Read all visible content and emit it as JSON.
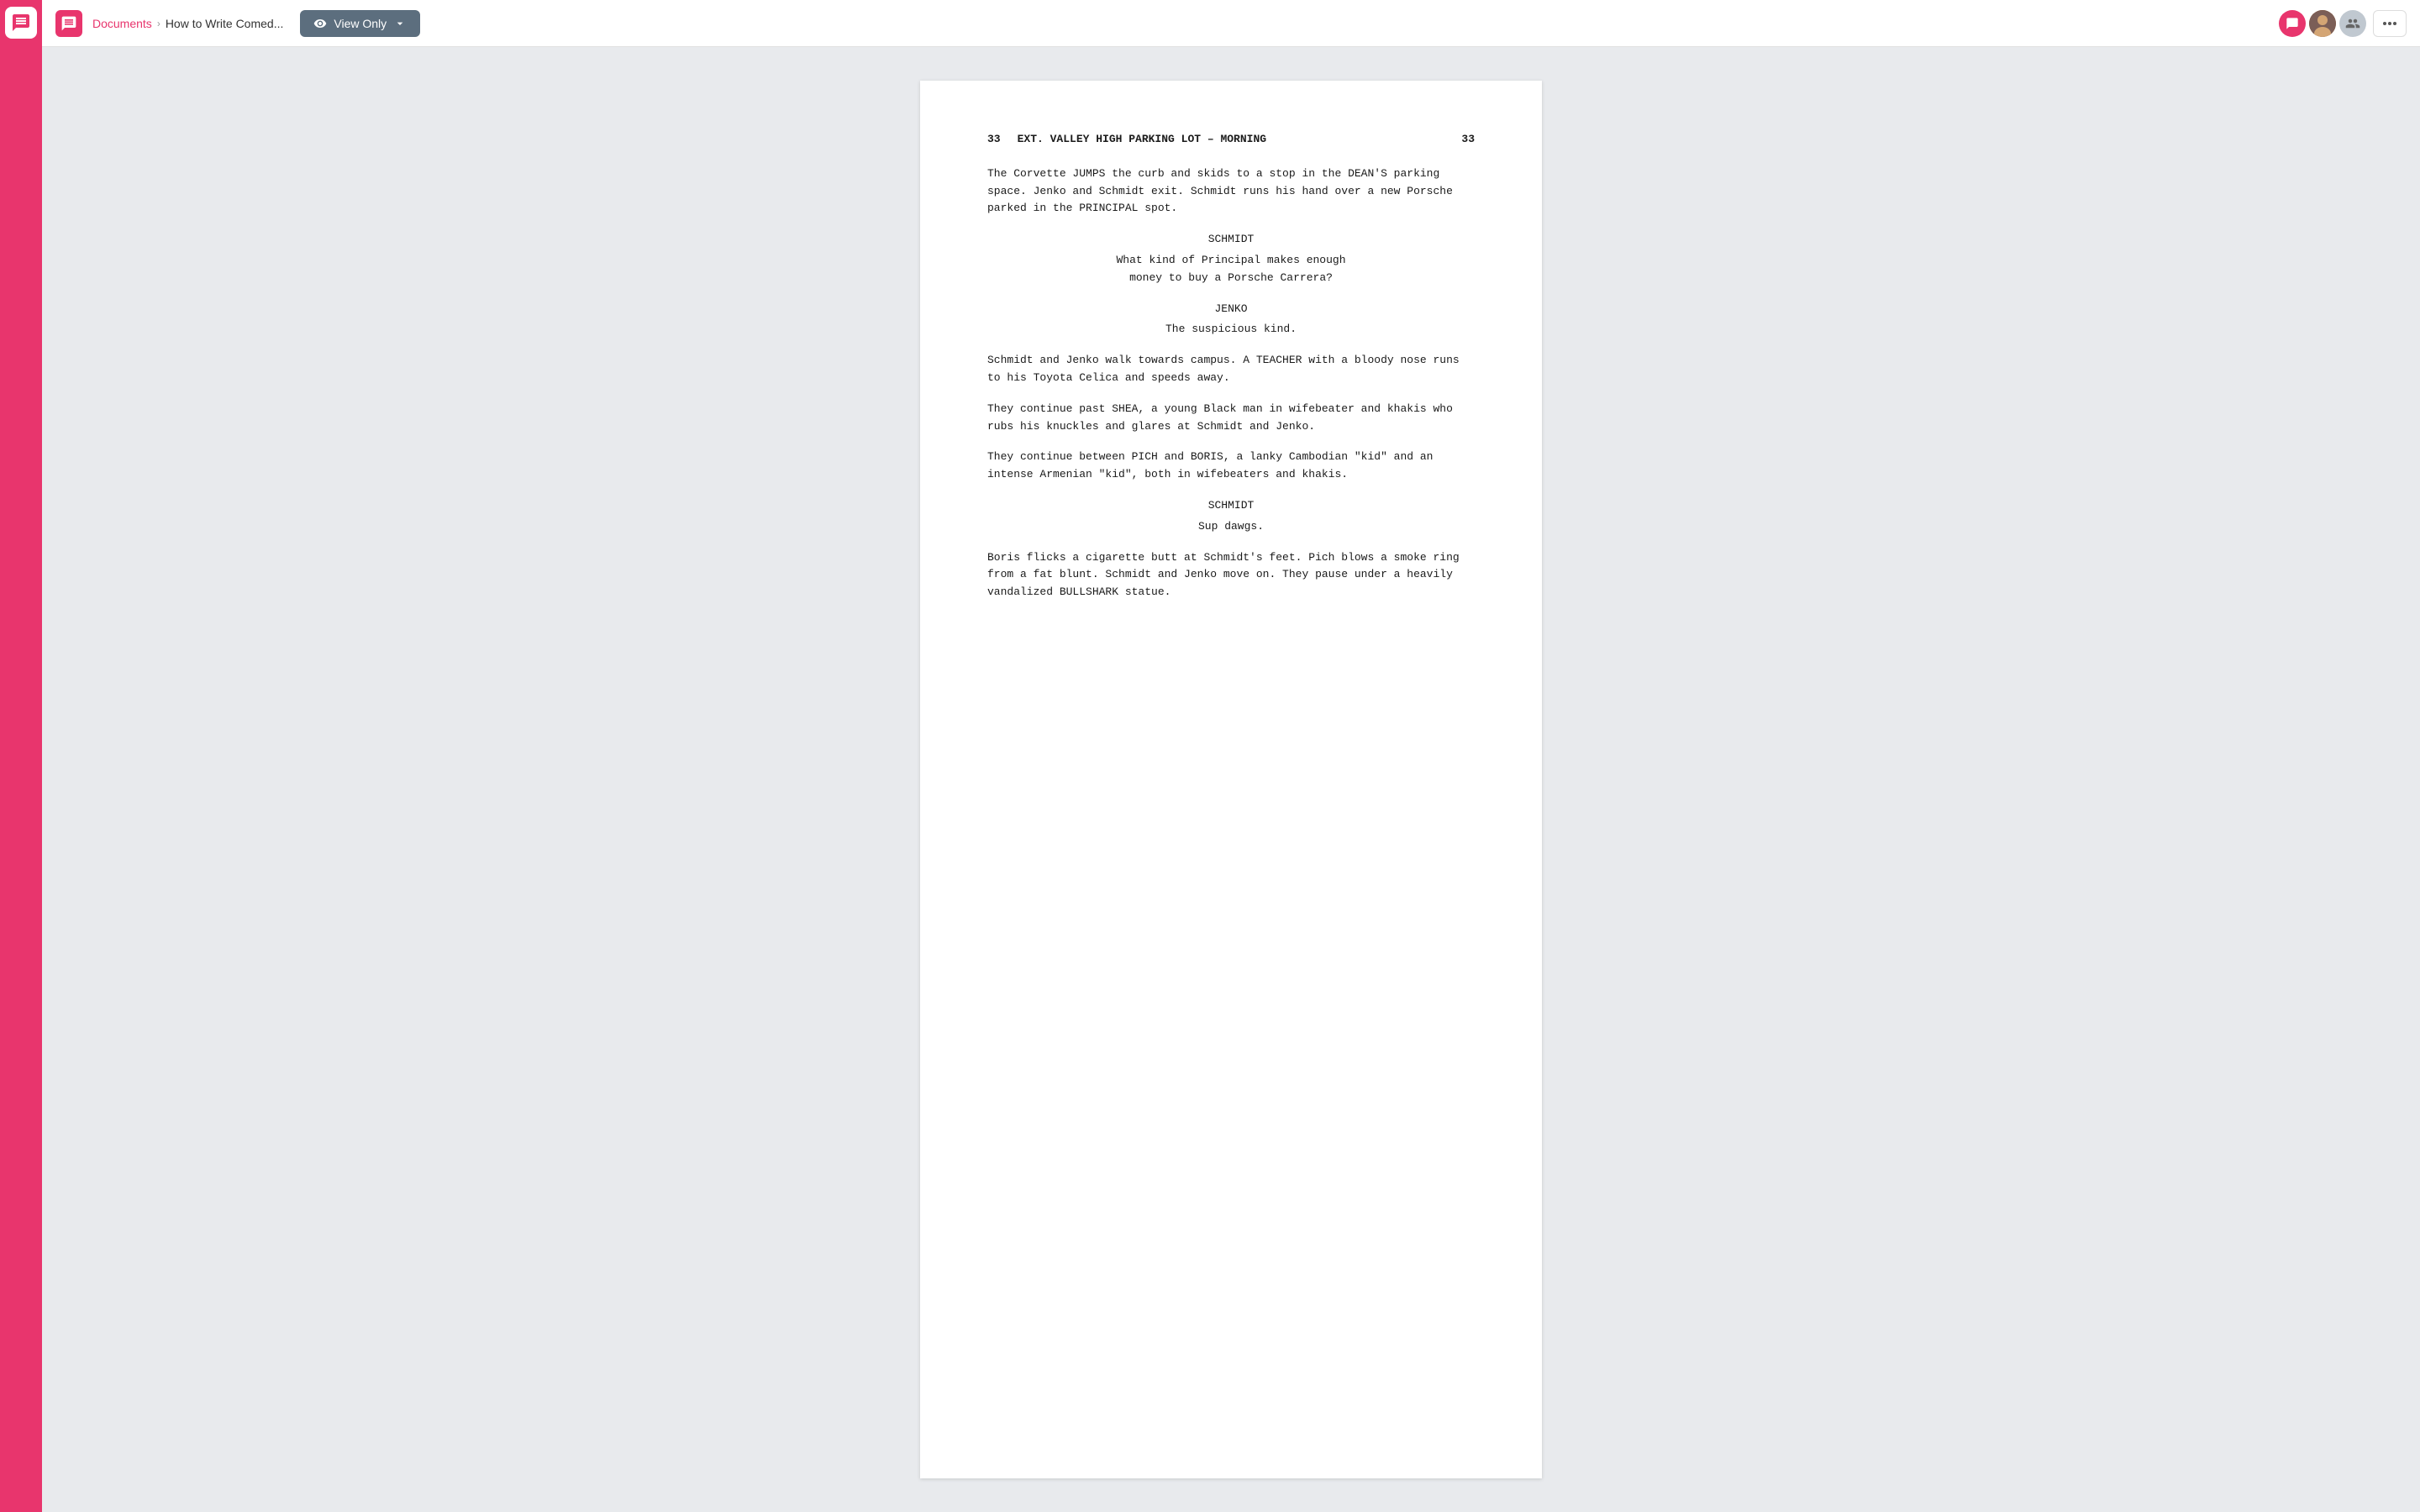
{
  "sidebar": {
    "logo_label": "Chat app logo"
  },
  "header": {
    "icon_label": "document icon",
    "breadcrumb_link": "Documents",
    "separator": "›",
    "document_title": "How to Write Comed...",
    "view_only_label": "View Only",
    "more_label": "···"
  },
  "document": {
    "scene_number_left": "33",
    "scene_number_right": "33",
    "scene_heading": "EXT. VALLEY HIGH PARKING LOT – MORNING",
    "action1": "The Corvette JUMPS the curb and skids to a stop in the DEAN'S parking space. Jenko and Schmidt exit. Schmidt runs his hand over a new Porsche parked in the PRINCIPAL spot.",
    "character1": "SCHMIDT",
    "dialogue1": "What kind of Principal makes enough\nmoney to buy a Porsche Carrera?",
    "character2": "JENKO",
    "dialogue2": "The suspicious kind.",
    "action2": "Schmidt and Jenko walk towards campus. A TEACHER with a bloody nose runs to his Toyota Celica and speeds away.",
    "action3": "They continue past SHEA, a young Black man in wifebeater and khakis who rubs his knuckles and glares at Schmidt and Jenko.",
    "action4": "They continue between PICH and BORIS, a lanky Cambodian \"kid\" and an intense Armenian \"kid\", both in wifebeaters and khakis.",
    "character3": "SCHMIDT",
    "dialogue3": "Sup dawgs.",
    "action5": "Boris flicks a cigarette butt at Schmidt's feet. Pich blows a smoke ring from a fat blunt. Schmidt and Jenko move on. They pause under a heavily vandalized BULLSHARK statue."
  }
}
